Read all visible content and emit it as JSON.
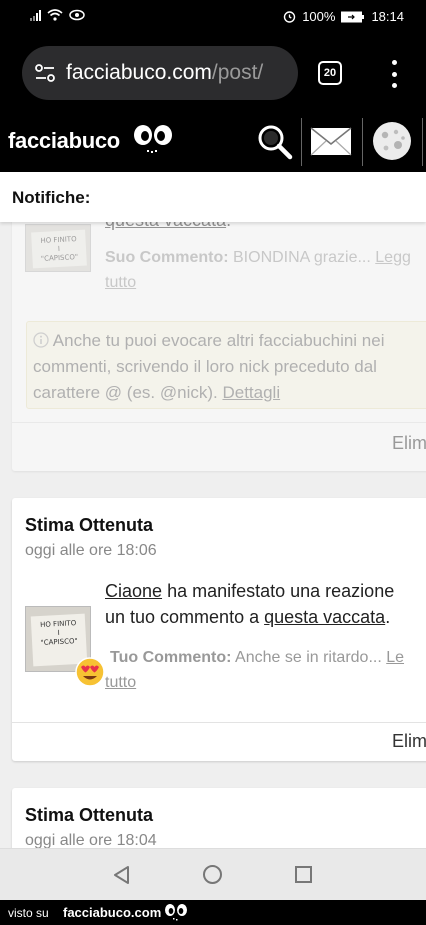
{
  "status_bar": {
    "battery": "100%",
    "time": "18:14"
  },
  "browser": {
    "url_host": "facciabuco.com",
    "url_path": "/post/",
    "tab_count": "20"
  },
  "site": {
    "logo": "facciabuco"
  },
  "notifications": {
    "header": "Notifiche:",
    "faded_card": {
      "link_text": "questa vaccata",
      "link_suffix": ".",
      "comment_label": "Suo Commento:",
      "comment_text": "BIONDINA grazie...",
      "read_more_1": "Legg",
      "read_more_2": "tutto",
      "info_text_1": "Anche tu puoi evocare altri facciabuchini nei",
      "info_text_2": "commenti, scrivendo il loro nick preceduto dal",
      "info_text_3": "carattere @ (es. @nick).",
      "info_link": "Dettagli",
      "delete_label": "Elim"
    },
    "card1": {
      "title": "Stima Ottenuta",
      "time": "oggi alle ore 18:06",
      "user": "Ciaone",
      "line1_rest": "ha manifestato una reazione",
      "line2_prefix": "un tuo commento a",
      "post_link": "questa vaccata",
      "line2_suffix": ".",
      "comment_label": "Tuo Commento:",
      "comment_text": "Anche se in ritardo...",
      "read_more_1": "Le",
      "read_more_2": "tutto",
      "delete_label": "Elim"
    },
    "card2": {
      "title": "Stima Ottenuta",
      "time": "oggi alle ore 18:04"
    }
  },
  "thumb_text": {
    "l1": "HO FINITO",
    "l2": "I",
    "l3": "\"CAPISCO\""
  },
  "footer": {
    "prefix": "visto su",
    "brand": "facciabuco.com"
  }
}
